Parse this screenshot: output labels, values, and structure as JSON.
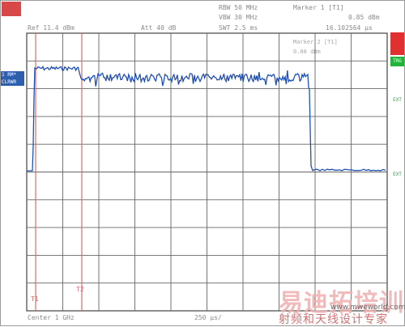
{
  "header": {
    "rbw": "RBW 50 MHz",
    "vbw": "VBW 30 MHz",
    "swt": "SWT 2.5 ms",
    "ref": "Ref  11.4 dBm",
    "att": "Att  40 dB",
    "marker_title": "Marker 1 [T1]",
    "marker_level": "0.85 dBm",
    "marker_pos": "16.102564 µs",
    "marker2_title": "Marker 2 [T1]",
    "marker2_level": "0.00 dBm"
  },
  "side_tag": {
    "line1": "1 RM*",
    "line2": "CLRWR"
  },
  "right_bar": {
    "sgl": "",
    "trg": "TRG",
    "ext": "EXT"
  },
  "markers": {
    "m1": "T1",
    "m2": "T2"
  },
  "footer": {
    "center": "Center 1 GHz",
    "span": "250 µs/"
  },
  "watermark": {
    "big": "易迪拓培训",
    "url": "www.mweworld.com.cn",
    "sub": "射频和天线设计专家"
  },
  "colors": {
    "trace": "#1e4fb8",
    "grid": "#555555",
    "marker_line": "#e06a6a",
    "tag": "#2e5fae"
  }
}
